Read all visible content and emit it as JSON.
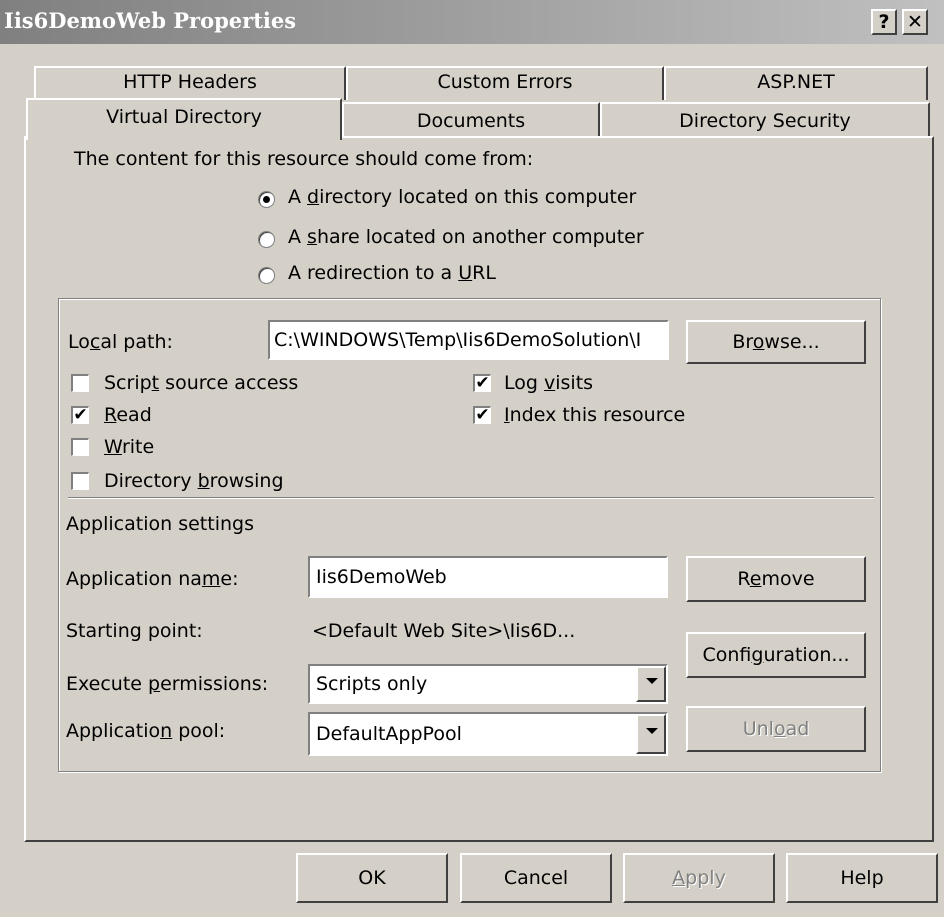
{
  "window": {
    "title": "Iis6DemoWeb Properties",
    "help_button": "?",
    "close_button": "✕"
  },
  "tabs": {
    "row1": [
      "HTTP Headers",
      "Custom Errors",
      "ASP.NET"
    ],
    "row2": [
      "Virtual Directory",
      "Documents",
      "Directory Security"
    ],
    "active": "Virtual Directory"
  },
  "content_source": {
    "heading": "The content for this resource should come from:",
    "options": [
      {
        "pre": "A ",
        "key": "d",
        "post": "irectory located on this computer",
        "selected": true
      },
      {
        "pre": "A ",
        "key": "s",
        "post": "hare located on another computer",
        "selected": false
      },
      {
        "pre": "A redirection to a ",
        "key": "U",
        "post": "RL",
        "selected": false
      }
    ]
  },
  "local_path": {
    "label_pre": "Lo",
    "label_key": "c",
    "label_post": "al path:",
    "value": "C:\\WINDOWS\\Temp\\Iis6DemoSolution\\I",
    "browse_pre": "Br",
    "browse_key": "o",
    "browse_post": "wse..."
  },
  "permissions": {
    "script_source": {
      "pre": "Scrip",
      "key": "t",
      "post": " source access",
      "checked": false
    },
    "read": {
      "pre": "",
      "key": "R",
      "post": "ead",
      "checked": true
    },
    "write": {
      "pre": "",
      "key": "W",
      "post": "rite",
      "checked": false
    },
    "dir_browsing": {
      "pre": "Directory ",
      "key": "b",
      "post": "rowsing",
      "checked": false
    },
    "log_visits": {
      "pre": "Log ",
      "key": "v",
      "post": "isits",
      "checked": true
    },
    "index": {
      "pre": "",
      "key": "I",
      "post": "ndex this resource",
      "checked": true
    }
  },
  "app_settings": {
    "heading": "Application settings",
    "name_label": {
      "pre": "Application na",
      "key": "m",
      "post": "e:"
    },
    "name_value": "Iis6DemoWeb",
    "remove": {
      "pre": "R",
      "key": "e",
      "post": "move"
    },
    "starting_point_label": "Starting point:",
    "starting_point_value": "<Default Web Site>\\Iis6D...",
    "configuration": {
      "pre": "Confi",
      "key": "g",
      "post": "uration..."
    },
    "exec_label": {
      "pre": "Execute ",
      "key": "p",
      "post": "ermissions:"
    },
    "exec_value": "Scripts only",
    "pool_label": {
      "pre": "Applicatio",
      "key": "n",
      "post": " pool:"
    },
    "pool_value": "DefaultAppPool",
    "unload": {
      "pre": "Unl",
      "key": "o",
      "post": "ad"
    }
  },
  "footer": {
    "ok": "OK",
    "cancel": "Cancel",
    "apply": {
      "pre": "",
      "key": "A",
      "post": "pply"
    },
    "help": "Help"
  }
}
